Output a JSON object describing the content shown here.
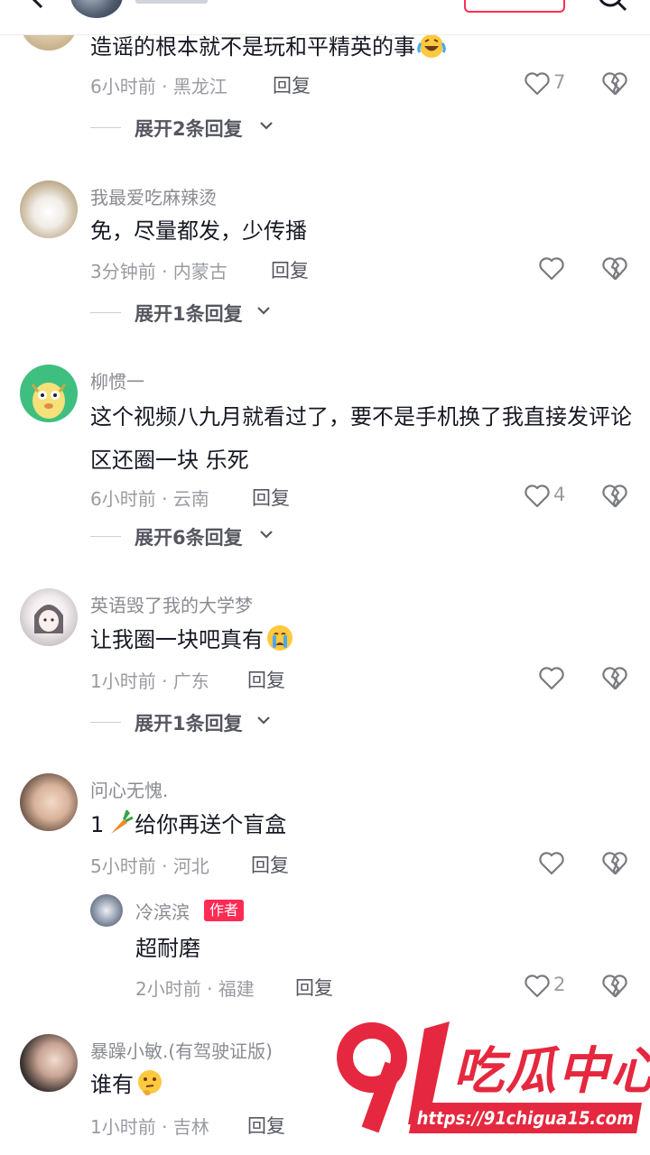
{
  "header": {},
  "expand_suffix": "",
  "comments": [
    {
      "text": "造谣的根本就不是玩和平精英的事",
      "time": "6小时前 · 黑龙江",
      "reply": "回复",
      "likes": "7",
      "expand": "展开2条回复"
    },
    {
      "name": "我最爱吃麻辣烫",
      "text": "免，尽量都发，少传播",
      "time": "3分钟前 · 内蒙古",
      "reply": "回复",
      "likes": "",
      "expand": "展开1条回复"
    },
    {
      "name": "柳惯一",
      "text": "这个视频八九月就看过了，要不是手机换了我直接发评论区还圈一块 乐死",
      "time": "6小时前 · 云南",
      "reply": "回复",
      "likes": "4",
      "expand": "展开6条回复"
    },
    {
      "name": "英语毁了我的大学梦",
      "text": "让我圈一块吧真有",
      "time": "1小时前 · 广东",
      "reply": "回复",
      "likes": "",
      "expand": "展开1条回复"
    },
    {
      "name": "问心无愧.",
      "text": "1",
      "text_after_emoji": "给你再送个盲盒",
      "time": "5小时前 · 河北",
      "reply": "回复",
      "likes": ""
    },
    {
      "name": "暴躁小敏.(有驾驶证版)",
      "text": "谁有",
      "time": "1小时前 · 吉林",
      "reply": "回复",
      "likes": ""
    }
  ],
  "sub_reply": {
    "name": "冷滨滨",
    "badge": "作者",
    "text": "超耐磨",
    "time": "2小时前 · 福建",
    "reply": "回复",
    "likes": "2"
  },
  "icons": {
    "like": "heart-outline-icon",
    "dislike": "broken-heart-icon",
    "expand": "chevron-down-icon",
    "back": "back-arrow-icon",
    "search": "search-icon"
  },
  "watermark": {
    "title": "吃瓜中心",
    "url": "https://91chigua15.com"
  },
  "colors": {
    "accent": "#fe2c55",
    "watermark": "#e5283f",
    "secondary_text": "#9a9ba1"
  }
}
